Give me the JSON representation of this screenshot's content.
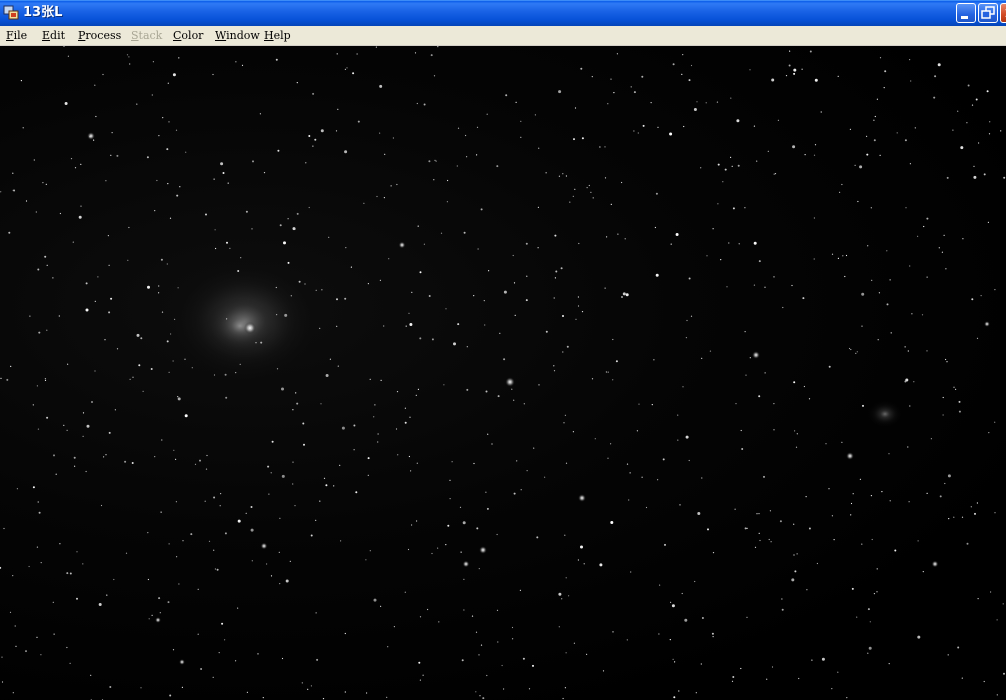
{
  "window": {
    "title": "13张L",
    "icon": "app-icon",
    "controls": {
      "minimize": "minimize-icon",
      "restore": "restore-icon",
      "close": "close-icon"
    }
  },
  "menu": [
    {
      "label": "File",
      "accel": "F",
      "rest": "ile",
      "enabled": true
    },
    {
      "label": "Edit",
      "accel": "E",
      "rest": "dit",
      "enabled": true
    },
    {
      "label": "Process",
      "accel": "P",
      "rest": "rocess",
      "enabled": true
    },
    {
      "label": "Stack",
      "accel": "S",
      "rest": "tack",
      "enabled": false
    },
    {
      "label": "Color",
      "accel": "C",
      "rest": "olor",
      "enabled": true
    },
    {
      "label": "Window",
      "accel": "W",
      "rest": "indow",
      "enabled": true
    },
    {
      "label": "Help",
      "accel": "H",
      "rest": "elp",
      "enabled": true
    }
  ],
  "image": {
    "subject": "astronomical star field image",
    "background_color": "#000000"
  },
  "colors": {
    "titlebar": "#0752d8",
    "menubar": "#ece9d8",
    "disabled_text": "#a9a795"
  }
}
